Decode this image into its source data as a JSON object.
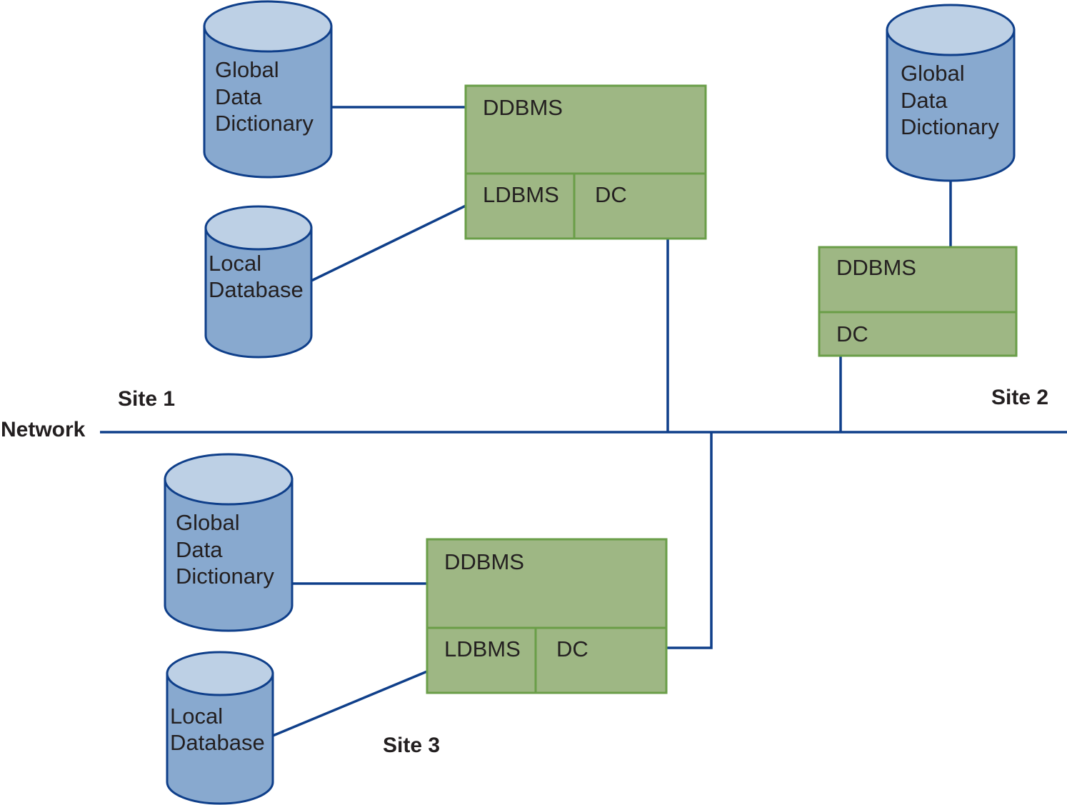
{
  "colors": {
    "cylinder_body": "#88a9cf",
    "cylinder_top": "#bdd0e5",
    "line": "#0f3f8a",
    "box_fill": "#9eb784",
    "box_stroke": "#6a9e48"
  },
  "network_label": "Network",
  "site1": {
    "label": "Site 1",
    "gdd": [
      "Global",
      "Data",
      "Dictionary"
    ],
    "ldb": [
      "Local",
      "Database"
    ],
    "ddbms": "DDBMS",
    "ldbms": "LDBMS",
    "dc": "DC"
  },
  "site2": {
    "label": "Site 2",
    "gdd": [
      "Global",
      "Data",
      "Dictionary"
    ],
    "ddbms": "DDBMS",
    "dc": "DC"
  },
  "site3": {
    "label": "Site 3",
    "gdd": [
      "Global",
      "Data",
      "Dictionary"
    ],
    "ldb": [
      "Local",
      "Database"
    ],
    "ddbms": "DDBMS",
    "ldbms": "LDBMS",
    "dc": "DC"
  }
}
